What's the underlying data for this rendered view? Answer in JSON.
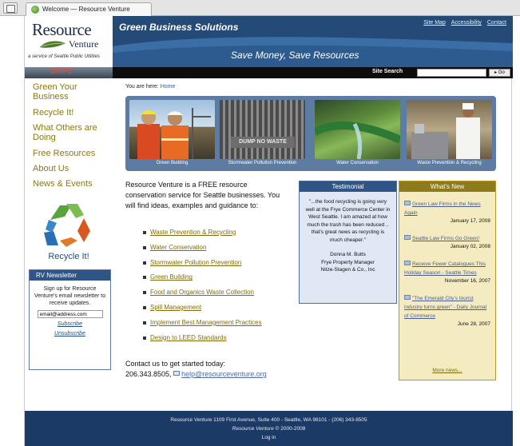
{
  "browser": {
    "tab_title": "Welcome — Resource Venture"
  },
  "header": {
    "logo_line1": "Resource",
    "logo_line2": "Venture",
    "logo_tagline": "a service of Seattle Public Utilities",
    "title": "Green Business Solutions",
    "slogan": "Save Money, Save Resources",
    "util_links": [
      "Site Map",
      "Accessibility",
      "Contact"
    ],
    "colors": {
      "header_blue": "#244a78",
      "nav_gold": "#8b7a0c",
      "accent_blue": "#2f5486"
    }
  },
  "search": {
    "label": "Site Search",
    "value": "",
    "button": "Go",
    "strip_sign": "DIFFE"
  },
  "nav": {
    "items": [
      "Green Your Business",
      "Recycle It!",
      "What Others are Doing",
      "Free Resources",
      "About Us",
      "News & Events"
    ],
    "recycle_label": "Recycle It!"
  },
  "newsletter": {
    "title": "RV Newsletter",
    "text": "Sign up for Resource Venture's email newsletter to receive updates.",
    "email_value": "email@address.com",
    "subscribe": "Subscribe",
    "unsubscribe": "Unsubscribe"
  },
  "breadcrumb": {
    "prefix": "You are here:",
    "home": "Home"
  },
  "photos": [
    {
      "caption": "Green Building"
    },
    {
      "caption": "Stormwater Pollution Prevention",
      "sign_text": "DUMP NO WASTE"
    },
    {
      "caption": "Water Conservation"
    },
    {
      "caption": "Waste Prevention & Recycling"
    }
  ],
  "intro": "Resource Venture is a FREE resource conservation service for Seattle businesses. You will find ideas, examples and guidance to:",
  "services": [
    "Waste Prevention & Recycling",
    "Water Conservation",
    "Stormwater Pollution Prevention",
    "Green Building",
    "Food and Organics Waste Collection",
    "Spill Management",
    "Implement Best Management Practices",
    "Design to LEED Standards"
  ],
  "contact": {
    "line": "Contact us to get started today:",
    "phone": "206.343.8505,",
    "email": "help@resourceventure.org"
  },
  "testimonial": {
    "title": "Testimonial",
    "quote": "\"...the food recycling is going very well at the Frye Commerce Center in West Seattle. I am amazed at how much the trash has been reduced .. that's great news as recycling is much cheaper.\"",
    "name": "Donna M. Butts",
    "role": "Frye Property Manager",
    "company": "Nitze-Stagen & Co., Inc"
  },
  "whats_new": {
    "title": "What's New",
    "items": [
      {
        "text": "Green Law Firms in the News Again",
        "date": "January 17, 2008"
      },
      {
        "text": "Seattle Law Firms Go Green!",
        "date": "January 02, 2008"
      },
      {
        "text": "Receive Fewer Catalogues This Holiday Season - Seattle Times",
        "date": "November 16, 2007"
      },
      {
        "text": "\"The Emerald City's tourist industry turns green\" - Daily Journal of Commerce",
        "date": "June 28, 2007"
      }
    ],
    "more": "More news..."
  },
  "footer": {
    "address": "Resource Venture 1109 First Avenue, Suite 400 - Seattle, WA 98101 - (206) 343-8505",
    "copyright_brand": "Resource Venture",
    "copyright_rest": "© 2000-2008",
    "login": "Log in"
  }
}
